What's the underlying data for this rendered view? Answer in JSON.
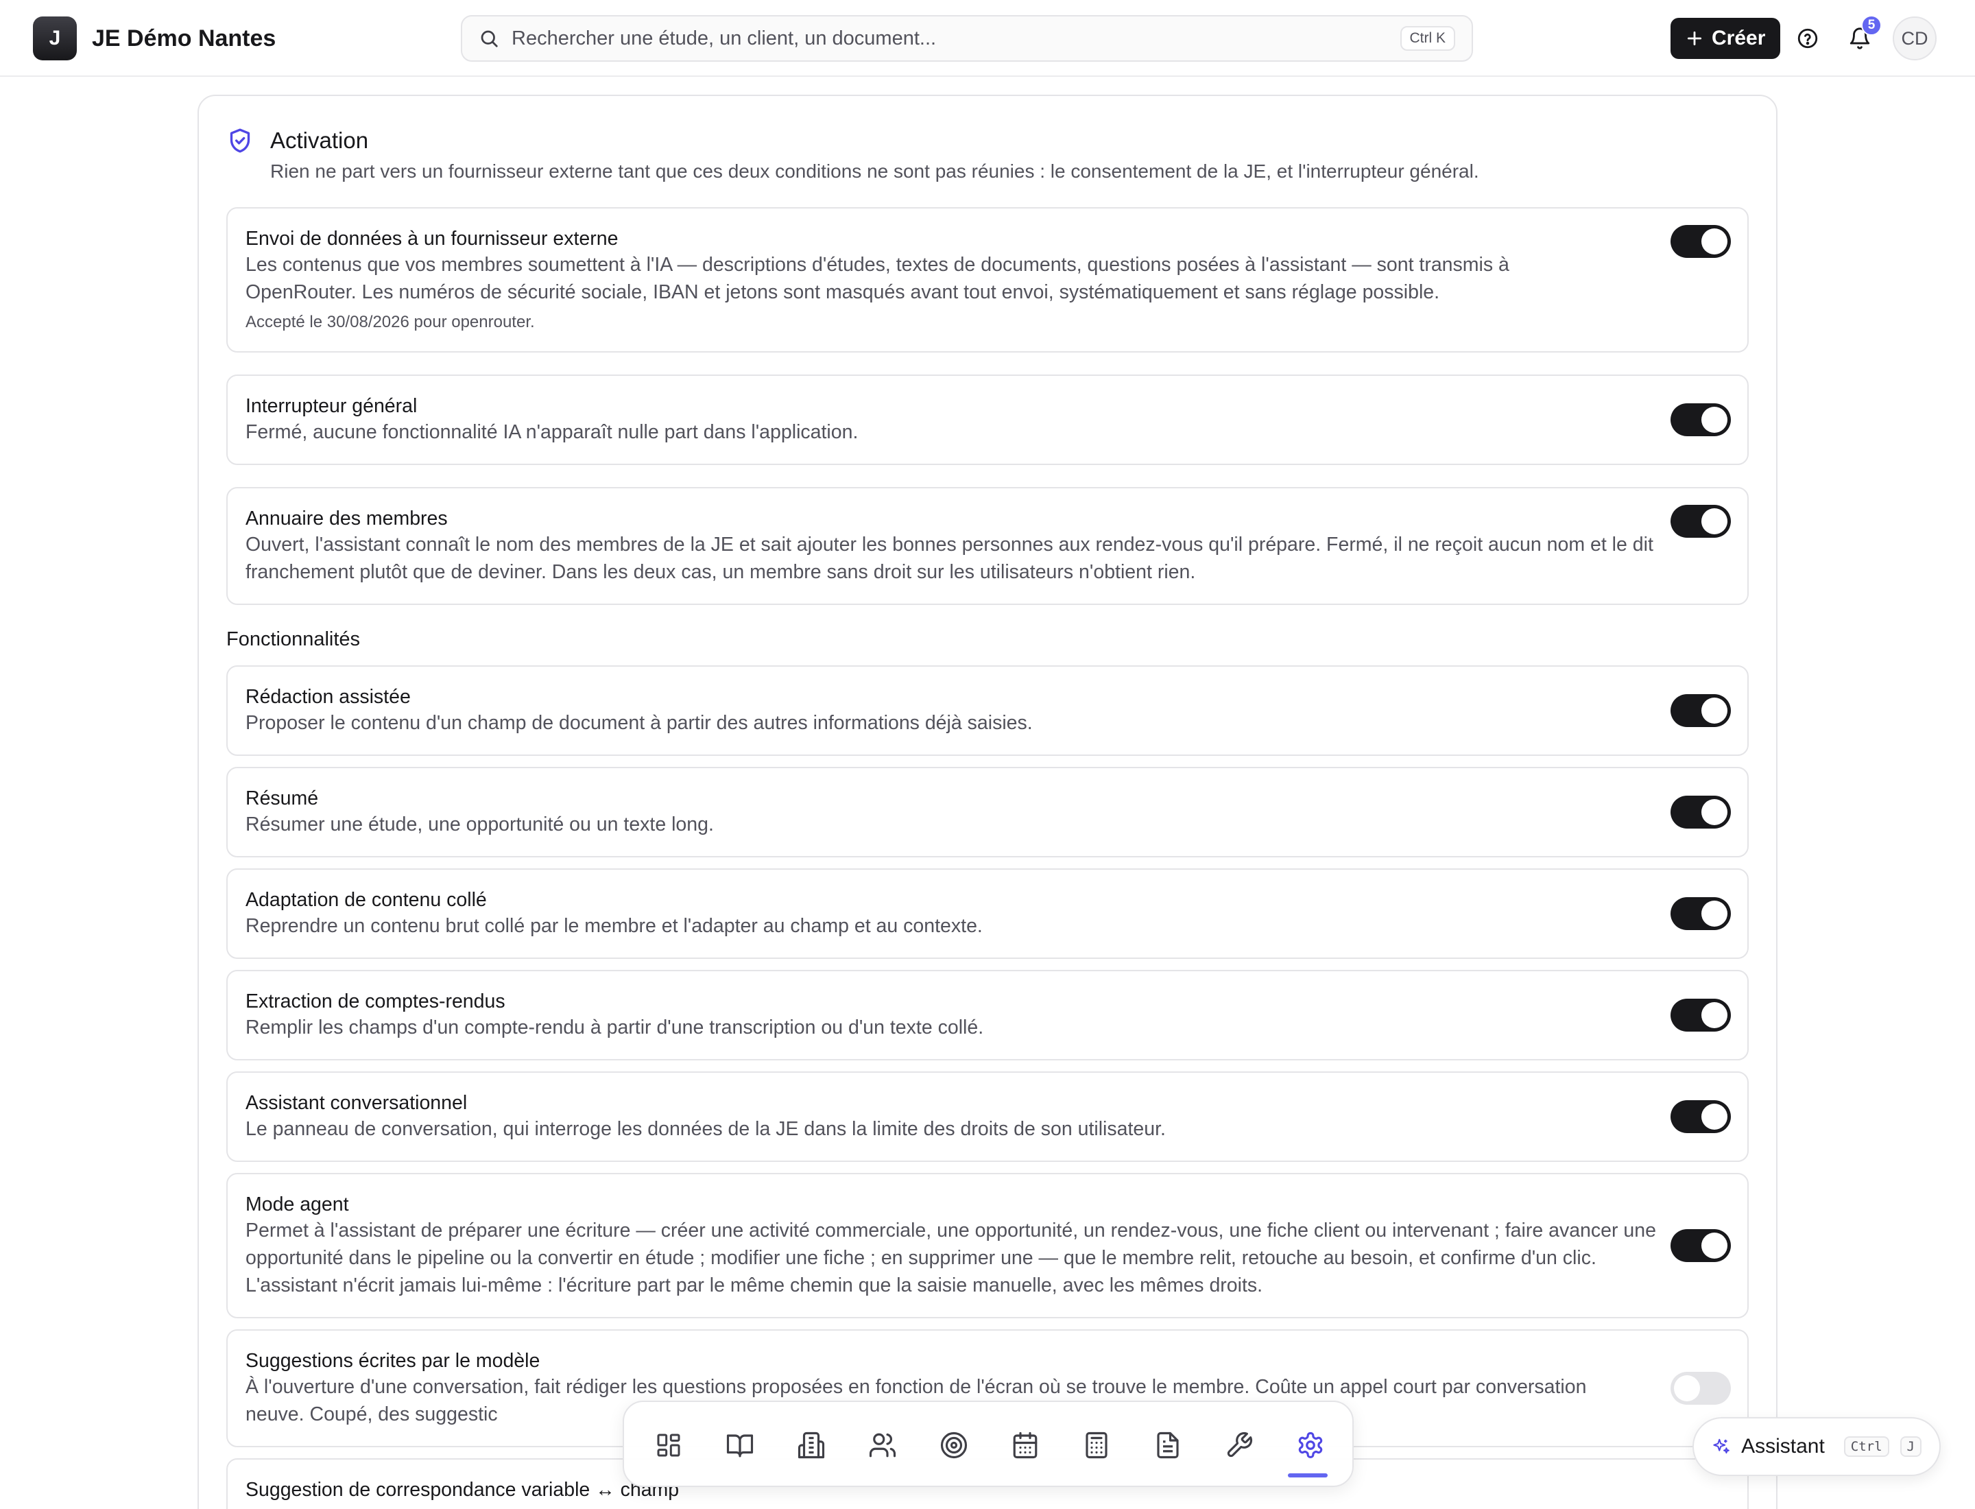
{
  "header": {
    "logo_letter": "J",
    "app_name": "JE Démo Nantes",
    "search_placeholder": "Rechercher une étude, un client, un document...",
    "search_shortcut": "Ctrl K",
    "create_label": "Créer",
    "notifications_count": "5",
    "avatar_initials": "CD"
  },
  "activation": {
    "title": "Activation",
    "subtitle": "Rien ne part vers un fournisseur externe tant que ces deux conditions ne sont pas réunies : le consentement de la JE, et l'interrupteur général."
  },
  "settings": [
    {
      "title": "Envoi de données à un fournisseur externe",
      "description": "Les contenus que vos membres soumettent à l'IA — descriptions d'études, textes de documents, questions posées à l'assistant — sont transmis à OpenRouter. Les numéros de sécurité sociale, IBAN et jetons sont masqués avant tout envoi, systématiquement et sans réglage possible.",
      "meta": "Accepté le 30/08/2026 pour openrouter.",
      "enabled": true
    },
    {
      "title": "Interrupteur général",
      "description": "Fermé, aucune fonctionnalité IA n'apparaît nulle part dans l'application.",
      "enabled": true
    },
    {
      "title": "Annuaire des membres",
      "description": "Ouvert, l'assistant connaît le nom des membres de la JE et sait ajouter les bonnes personnes aux rendez-vous qu'il prépare. Fermé, il ne reçoit aucun nom et le dit franchement plutôt que de deviner. Dans les deux cas, un membre sans droit sur les utilisateurs n'obtient rien.",
      "enabled": true
    }
  ],
  "features_section_label": "Fonctionnalités",
  "features": [
    {
      "title": "Rédaction assistée",
      "description": "Proposer le contenu d'un champ de document à partir des autres informations déjà saisies.",
      "enabled": true
    },
    {
      "title": "Résumé",
      "description": "Résumer une étude, une opportunité ou un texte long.",
      "enabled": true
    },
    {
      "title": "Adaptation de contenu collé",
      "description": "Reprendre un contenu brut collé par le membre et l'adapter au champ et au contexte.",
      "enabled": true
    },
    {
      "title": "Extraction de comptes-rendus",
      "description": "Remplir les champs d'un compte-rendu à partir d'une transcription ou d'un texte collé.",
      "enabled": true
    },
    {
      "title": "Assistant conversationnel",
      "description": "Le panneau de conversation, qui interroge les données de la JE dans la limite des droits de son utilisateur.",
      "enabled": true
    },
    {
      "title": "Mode agent",
      "description": "Permet à l'assistant de préparer une écriture — créer une activité commerciale, une opportunité, un rendez-vous, une fiche client ou intervenant ; faire avancer une opportunité dans le pipeline ou la convertir en étude ; modifier une fiche ; en supprimer une — que le membre relit, retouche au besoin, et confirme d'un clic. L'assistant n'écrit jamais lui-même : l'écriture part par le même chemin que la saisie manuelle, avec les mêmes droits.",
      "enabled": true
    },
    {
      "title": "Suggestions écrites par le modèle",
      "description": "À l'ouverture d'une conversation, fait rédiger les questions proposées en fonction de l'écran où se trouve le membre. Coûte un appel court par conversation neuve. Coupé, des suggestic",
      "enabled": false
    },
    {
      "title": "Suggestion de correspondance variable ↔ champ",
      "enabled": null
    }
  ],
  "dock": {
    "items": [
      "grid-icon",
      "book-icon",
      "building-icon",
      "users-icon",
      "target-icon",
      "calendar-icon",
      "calculator-icon",
      "document-icon",
      "wrench-icon",
      "settings-icon"
    ],
    "active": "settings-icon",
    "accent": "#6366f1"
  },
  "assistant": {
    "label": "Assistant",
    "key1": "Ctrl",
    "key2": "J"
  }
}
